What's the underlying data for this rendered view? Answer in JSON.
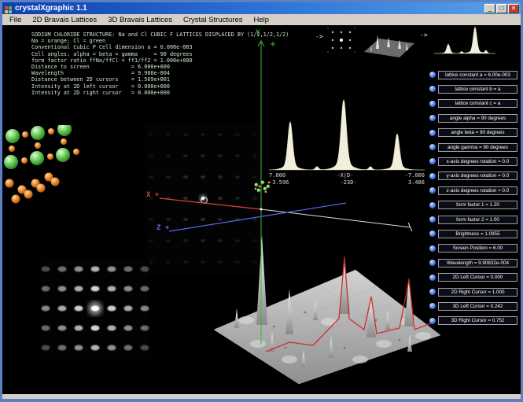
{
  "window": {
    "title": "crystalXgraphic 1.1",
    "minimize_glyph": "_",
    "maximize_glyph": "□",
    "close_glyph": "✕"
  },
  "menu": {
    "items": [
      "File",
      "2D Bravais Lattices",
      "3D Bravais Lattices",
      "Crystal Structures",
      "Help"
    ]
  },
  "info": {
    "lines": [
      "SODIUM CHLORIDE STRUCTURE: Na and Cl CUBIC F LATTICES DISPLACED BY (1/2,1/2,1/2)",
      "Na = orange; Cl = green",
      "Conventional Cubic P Cell dimension a = 6.000e-003",
      "Cell angles: alpha = beta = gamma     = 90 degrees",
      "form factor ratio ffNa/ffCl = ff1/ff2 = 1.000e+000",
      "Distance to screen             = 6.000e+000",
      "Wavelength                     = 9.908e-004",
      "Distance between 2D cursors    = 1.569e+001",
      "Intensity at 2D left cursor    = 0.000e+000",
      "Intensity at 2D right cursor   = 0.000e+000"
    ]
  },
  "arrows": [
    "->",
    "->"
  ],
  "axes": {
    "y_label": "Y",
    "x_label": "X +",
    "z_label": "Z +"
  },
  "profile_labels": {
    "row1": [
      "7.000",
      "-X|D-",
      "-7.000"
    ],
    "row2": [
      "-3.596",
      "-23D-",
      "3.486"
    ]
  },
  "sliders": {
    "items": [
      "lattice constant a = 6.00e-003",
      "lattice constant b = a",
      "lattice constant c = a",
      "angle alpha = 90 degrees",
      "angle beta = 90 degrees",
      "angle gamma = 90 degrees",
      "x-axis degrees rotation = 0.0",
      "y-axis degrees rotation = 0.0",
      "z-axis degrees rotation = 0.0",
      "form factor 1 = 1.20",
      "form factor 2 = 1.00",
      "Brightness = 1.0955",
      "Screen Position = 6.00",
      "Wavelength = 9.90832e-004",
      "2D Left Cursor = 0.000",
      "2D Right Cursor = 1.000",
      "3D Left Cursor = 0.242",
      "3D Right Cursor = 0.752"
    ]
  },
  "colors": {
    "na_orange": "#e07818",
    "cl_green": "#50b840",
    "peak_fill": "#f2eedc",
    "axis_x": "#e04040",
    "axis_y": "#3db53d",
    "axis_z": "#5868e8",
    "surface_red": "#cc2828"
  }
}
